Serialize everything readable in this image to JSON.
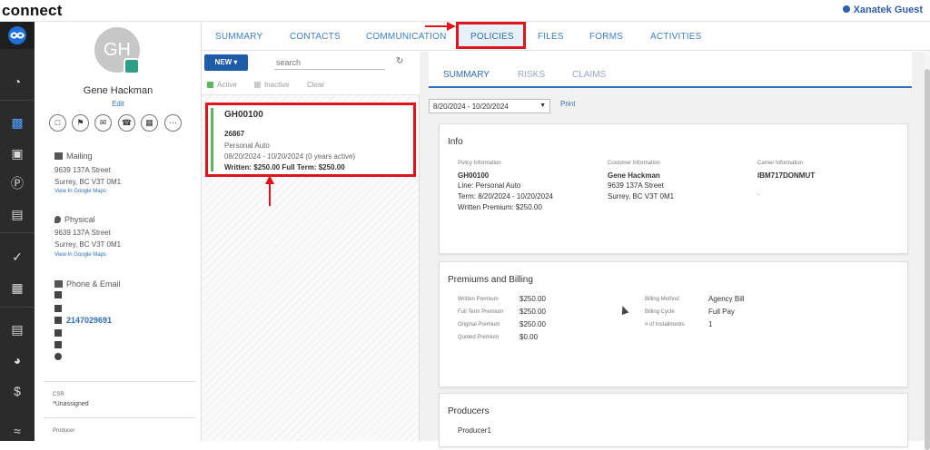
{
  "app": {
    "brand": "connect",
    "user": "Xanatek Guest"
  },
  "tabs": [
    "SUMMARY",
    "CONTACTS",
    "COMMUNICATION",
    "POLICIES",
    "FILES",
    "FORMS",
    "ACTIVITIES"
  ],
  "contact": {
    "initials": "GH",
    "name": "Gene Hackman",
    "edit": "Edit",
    "mailing_label": "Mailing",
    "mailing_lines": [
      "9639 137A Street",
      "Surrey, BC V3T 0M1"
    ],
    "physical_label": "Physical",
    "physical_lines": [
      "9639 137A Street",
      "Surrey, BC V3T 0M1"
    ],
    "maps_link": "View In Google Maps",
    "phone_email_label": "Phone & Email",
    "phone": "2147029691",
    "csr_label": "CSR",
    "csr_value": "*Unassigned",
    "producer_label": "Producer"
  },
  "policy_list": {
    "new_label": "NEW ▾",
    "search_placeholder": "search",
    "filters": {
      "active": "Active",
      "inactive": "Inactive",
      "clear": "Clear"
    },
    "card": {
      "policy_number": "GH00100",
      "id": "26867",
      "type": "Personal Auto",
      "term": "08/20/2024 - 10/20/2024 (0 years active)",
      "premiums": "Written: $250.00  Full Term: $250.00"
    }
  },
  "detail": {
    "subtabs": [
      "SUMMARY",
      "RISKS",
      "CLAIMS"
    ],
    "date_range": "8/20/2024 - 10/20/2024",
    "print": "Print",
    "info": {
      "title": "Info",
      "policy_label": "Policy Information",
      "policy_number": "GH00100",
      "line": "Line: Personal Auto",
      "term": "Term: 8/20/2024 - 10/20/2024",
      "written": "Written Premium: $250.00",
      "customer_label": "Customer Information",
      "customer_name": "Gene Hackman",
      "customer_addr1": "9639 137A Street",
      "customer_addr2": "Surrey, BC V3T 0M1",
      "carrier_label": "Carrier Information",
      "carrier_code": "IBM717DONMUT",
      "carrier_extra": "."
    },
    "premiums": {
      "title": "Premiums and Billing",
      "rows": [
        {
          "label": "Written Premium",
          "value": "$250.00"
        },
        {
          "label": "Full Term Premium",
          "value": "$250.00"
        },
        {
          "label": "Original Premium",
          "value": "$250.00"
        },
        {
          "label": "Quoted Premium",
          "value": "$0.00"
        }
      ],
      "billing": [
        {
          "label": "Billing Method",
          "value": "Agency Bill"
        },
        {
          "label": "Billing Cycle",
          "value": "Full Pay"
        },
        {
          "label": "# of Installments",
          "value": "1"
        }
      ]
    },
    "producers": {
      "title": "Producers",
      "first": "Producer1"
    }
  },
  "colors": {
    "accent": "#2f6fb8",
    "highlight": "#e0141c",
    "active": "#5cb85c"
  }
}
